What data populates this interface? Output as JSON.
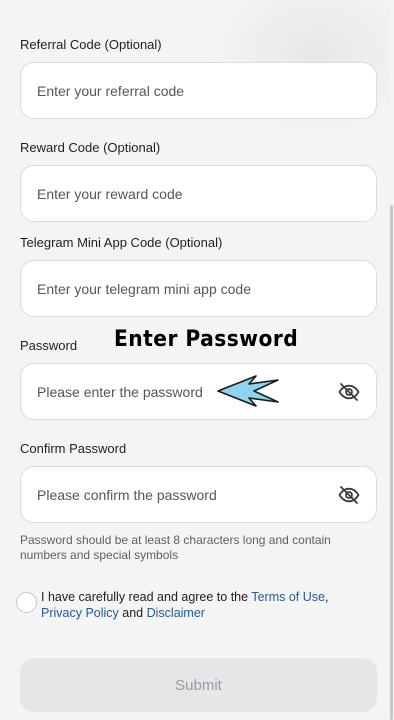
{
  "form": {
    "referral": {
      "label": "Referral Code (Optional)",
      "placeholder": "Enter your referral code",
      "value": ""
    },
    "reward": {
      "label": "Reward Code (Optional)",
      "placeholder": "Enter your reward code",
      "value": ""
    },
    "telegram": {
      "label": "Telegram Mini App Code (Optional)",
      "placeholder": "Enter your telegram mini app code",
      "value": ""
    },
    "password": {
      "label": "Password",
      "placeholder": "Please enter the password",
      "value": "",
      "toggle_icon": "eye-off-icon"
    },
    "confirm_password": {
      "label": "Confirm Password",
      "placeholder": "Please confirm the password",
      "value": "",
      "toggle_icon": "eye-off-icon"
    },
    "password_hint": "Password should be at least 8 characters long and contain numbers and special symbols",
    "agreement": {
      "prefix": "I have carefully read and agree to the ",
      "terms_link": "Terms of Use",
      "comma": ", ",
      "privacy_link": "Privacy Policy",
      "and": " and ",
      "disclaimer_link": "Disclaimer",
      "checked": false
    },
    "submit_label": "Submit"
  },
  "annotation": {
    "text": "Enter Password",
    "arrow_color": "#8fd3ee"
  },
  "colors": {
    "background": "#f4f4f5",
    "field_border": "#dcdce0",
    "link": "#245a9c",
    "submit_bg": "#e6e6e9",
    "submit_text": "#9a9ba0"
  }
}
